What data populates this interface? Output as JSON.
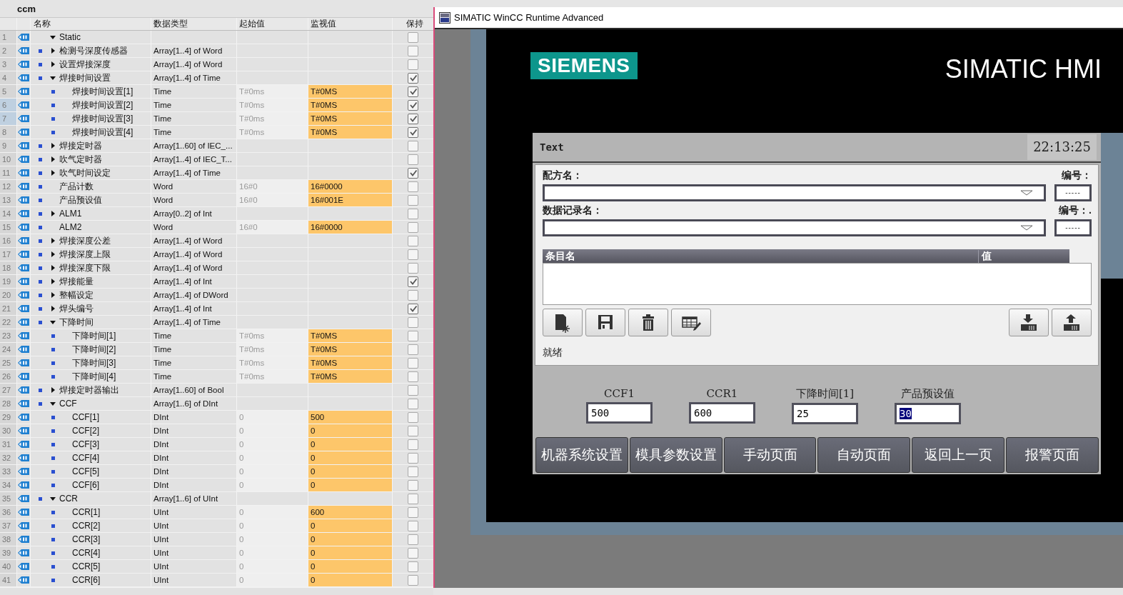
{
  "editor": {
    "title": "ccm",
    "columns": [
      "名称",
      "数据类型",
      "起始值",
      "监视值",
      "保持"
    ],
    "rows": [
      {
        "no": "1",
        "name": "Static",
        "retain": false,
        "expanded": true,
        "selected": false,
        "children": [
          {
            "no": "2",
            "name": "检测号深度传感器",
            "type": "Array[1..4] of Word",
            "retain": false,
            "expanded": false,
            "selected": false
          },
          {
            "no": "3",
            "name": "设置焊接深度",
            "type": "Array[1..4] of Word",
            "retain": false,
            "expanded": false,
            "selected": false
          },
          {
            "no": "4",
            "name": "焊接时间设置",
            "type": "Array[1..4] of Time",
            "retain": true,
            "expanded": true,
            "selected": false,
            "children": [
              {
                "no": "5",
                "name": "焊接时间设置[1]",
                "type": "Time",
                "start": "T#0ms",
                "monitor": "T#0MS",
                "retain": true,
                "selected": false
              },
              {
                "no": "6",
                "name": "焊接时间设置[2]",
                "type": "Time",
                "start": "T#0ms",
                "monitor": "T#0MS",
                "retain": true,
                "selected": true
              },
              {
                "no": "7",
                "name": "焊接时间设置[3]",
                "type": "Time",
                "start": "T#0ms",
                "monitor": "T#0MS",
                "retain": true,
                "selected": true
              },
              {
                "no": "8",
                "name": "焊接时间设置[4]",
                "type": "Time",
                "start": "T#0ms",
                "monitor": "T#0MS",
                "retain": true,
                "selected": false
              }
            ]
          },
          {
            "no": "9",
            "name": "焊接定时器",
            "type": "Array[1..60] of IEC_...",
            "retain": false,
            "expanded": false,
            "selected": false
          },
          {
            "no": "10",
            "name": "吹气定时器",
            "type": "Array[1..4] of IEC_T...",
            "retain": false,
            "expanded": false,
            "selected": false
          },
          {
            "no": "11",
            "name": "吹气时间设定",
            "type": "Array[1..4] of Time",
            "retain": true,
            "expanded": false,
            "selected": false
          },
          {
            "no": "12",
            "name": "产品计数",
            "type": "Word",
            "start": "16#0",
            "monitor": "16#0000",
            "retain": false,
            "selected": false
          },
          {
            "no": "13",
            "name": "产品预设值",
            "type": "Word",
            "start": "16#0",
            "monitor": "16#001E",
            "retain": false,
            "selected": false
          },
          {
            "no": "14",
            "name": "ALM1",
            "type": "Array[0..2] of Int",
            "retain": false,
            "expanded": false,
            "selected": false
          },
          {
            "no": "15",
            "name": "ALM2",
            "type": "Word",
            "start": "16#0",
            "monitor": "16#0000",
            "retain": false,
            "selected": false
          },
          {
            "no": "16",
            "name": "焊接深度公差",
            "type": "Array[1..4] of Word",
            "retain": false,
            "expanded": false,
            "selected": false
          },
          {
            "no": "17",
            "name": "焊接深度上限",
            "type": "Array[1..4] of Word",
            "retain": false,
            "expanded": false,
            "selected": false
          },
          {
            "no": "18",
            "name": "焊接深度下限",
            "type": "Array[1..4] of Word",
            "retain": false,
            "expanded": false,
            "selected": false
          },
          {
            "no": "19",
            "name": "焊接能量",
            "type": "Array[1..4] of Int",
            "retain": true,
            "expanded": false,
            "selected": false
          },
          {
            "no": "20",
            "name": "整幅设定",
            "type": "Array[1..4] of DWord",
            "retain": false,
            "expanded": false,
            "selected": false
          },
          {
            "no": "21",
            "name": "焊头编号",
            "type": "Array[1..4] of Int",
            "retain": true,
            "expanded": false,
            "selected": false
          },
          {
            "no": "22",
            "name": "下降时间",
            "type": "Array[1..4] of Time",
            "retain": false,
            "expanded": true,
            "selected": false,
            "children": [
              {
                "no": "23",
                "name": "下降时间[1]",
                "type": "Time",
                "start": "T#0ms",
                "monitor": "T#0MS",
                "retain": false,
                "selected": false
              },
              {
                "no": "24",
                "name": "下降时间[2]",
                "type": "Time",
                "start": "T#0ms",
                "monitor": "T#0MS",
                "retain": false,
                "selected": false
              },
              {
                "no": "25",
                "name": "下降时间[3]",
                "type": "Time",
                "start": "T#0ms",
                "monitor": "T#0MS",
                "retain": false,
                "selected": false
              },
              {
                "no": "26",
                "name": "下降时间[4]",
                "type": "Time",
                "start": "T#0ms",
                "monitor": "T#0MS",
                "retain": false,
                "selected": false
              }
            ]
          },
          {
            "no": "27",
            "name": "焊接定时器输出",
            "type": "Array[1..60] of Bool",
            "retain": false,
            "expanded": false,
            "selected": false
          },
          {
            "no": "28",
            "name": "CCF",
            "type": "Array[1..6] of DInt",
            "retain": false,
            "expanded": true,
            "selected": false,
            "children": [
              {
                "no": "29",
                "name": "CCF[1]",
                "type": "DInt",
                "start": "0",
                "monitor": "500",
                "retain": false,
                "selected": false
              },
              {
                "no": "30",
                "name": "CCF[2]",
                "type": "DInt",
                "start": "0",
                "monitor": "0",
                "retain": false,
                "selected": false
              },
              {
                "no": "31",
                "name": "CCF[3]",
                "type": "DInt",
                "start": "0",
                "monitor": "0",
                "retain": false,
                "selected": false
              },
              {
                "no": "32",
                "name": "CCF[4]",
                "type": "DInt",
                "start": "0",
                "monitor": "0",
                "retain": false,
                "selected": false
              },
              {
                "no": "33",
                "name": "CCF[5]",
                "type": "DInt",
                "start": "0",
                "monitor": "0",
                "retain": false,
                "selected": false
              },
              {
                "no": "34",
                "name": "CCF[6]",
                "type": "DInt",
                "start": "0",
                "monitor": "0",
                "retain": false,
                "selected": false
              }
            ]
          },
          {
            "no": "35",
            "name": "CCR",
            "type": "Array[1..6] of UInt",
            "retain": false,
            "expanded": true,
            "selected": false,
            "children": [
              {
                "no": "36",
                "name": "CCR[1]",
                "type": "UInt",
                "start": "0",
                "monitor": "600",
                "retain": false,
                "selected": false
              },
              {
                "no": "37",
                "name": "CCR[2]",
                "type": "UInt",
                "start": "0",
                "monitor": "0",
                "retain": false,
                "selected": false
              },
              {
                "no": "38",
                "name": "CCR[3]",
                "type": "UInt",
                "start": "0",
                "monitor": "0",
                "retain": false,
                "selected": false
              },
              {
                "no": "39",
                "name": "CCR[4]",
                "type": "UInt",
                "start": "0",
                "monitor": "0",
                "retain": false,
                "selected": false
              },
              {
                "no": "40",
                "name": "CCR[5]",
                "type": "UInt",
                "start": "0",
                "monitor": "0",
                "retain": false,
                "selected": false
              },
              {
                "no": "41",
                "name": "CCR[6]",
                "type": "UInt",
                "start": "0",
                "monitor": "0",
                "retain": false,
                "selected": false
              }
            ]
          }
        ]
      }
    ]
  },
  "runtime": {
    "window": {
      "title": "SIMATIC WinCC Runtime Advanced"
    },
    "brand": "SIEMENS",
    "product": "SIMATIC HMI",
    "screen": {
      "header": "Text",
      "clock": "22:13:25",
      "recipe": {
        "name_label": "配方名：",
        "number_label": "编号：",
        "number_value": "-----"
      },
      "record": {
        "name_label": "数据记录名：",
        "number_label": "编号：.",
        "number_value": "-----"
      },
      "entry_columns": [
        "条目名",
        "值"
      ],
      "status": "就绪",
      "fields": [
        {
          "label": "CCF1",
          "value": "500",
          "selected": false
        },
        {
          "label": "CCR1",
          "value": "600",
          "selected": false
        },
        {
          "label": "下降时间[1]",
          "value": "25",
          "selected": false
        },
        {
          "label": "产品预设值",
          "value": "30",
          "selected": true
        }
      ],
      "nav_buttons": [
        "机器系统设置",
        "模具参数设置",
        "手动页面",
        "自动页面",
        "返回上一页",
        "报警页面"
      ]
    }
  }
}
